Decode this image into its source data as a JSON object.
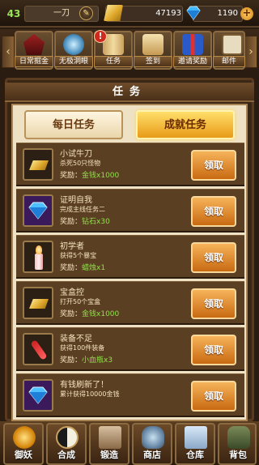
{
  "status": {
    "level": "43",
    "player_name": "一刀",
    "gold": "47193",
    "gems": "1190"
  },
  "nav": [
    {
      "label": "日常掘金",
      "icon": "house-icon"
    },
    {
      "label": "无极洞眼",
      "icon": "crystal-pool-icon"
    },
    {
      "label": "任务",
      "icon": "scroll-icon",
      "alert": "!"
    },
    {
      "label": "签到",
      "icon": "sign-in-icon"
    },
    {
      "label": "邀请奖励",
      "icon": "gift-icon"
    },
    {
      "label": "邮件",
      "icon": "mail-icon"
    }
  ],
  "panel": {
    "title": "任务",
    "tabs": {
      "daily": "每日任务",
      "achievement": "成就任务"
    },
    "selected_tab": "achievement"
  },
  "reward_prefix": "奖励：",
  "tasks": [
    {
      "title": "小试牛刀",
      "desc": "杀死50只怪物",
      "reward": "金钱x1000",
      "claim": "领取",
      "icon": "gold-bar-icon"
    },
    {
      "title": "证明自我",
      "desc": "完成主线任务二",
      "reward": "钻石x30",
      "claim": "领取",
      "icon": "diamond-icon"
    },
    {
      "title": "初学者",
      "desc": "获得5个暴宝",
      "reward": "蜡烛x1",
      "claim": "领取",
      "icon": "candle-icon"
    },
    {
      "title": "宝盒控",
      "desc": "打开50个宝盒",
      "reward": "金钱x1000",
      "claim": "领取",
      "icon": "gold-bar-icon"
    },
    {
      "title": "装备不足",
      "desc": "获得100件装备",
      "reward": "小血瓶x3",
      "claim": "领取",
      "icon": "potion-icon"
    },
    {
      "title": "有钱刷新了！",
      "desc": "累计获得10000金钱",
      "reward": "",
      "claim": "领取",
      "icon": "diamond-icon"
    }
  ],
  "bottom": [
    {
      "label": "御妖",
      "icon": "demon-seal-icon"
    },
    {
      "label": "合成",
      "icon": "yin-yang-icon"
    },
    {
      "label": "锻造",
      "icon": "book-icon"
    },
    {
      "label": "商店",
      "icon": "shop-bag-icon"
    },
    {
      "label": "仓库",
      "icon": "warehouse-icon"
    },
    {
      "label": "背包",
      "icon": "backpack-icon"
    }
  ],
  "colors": {
    "reward_value": "#8fe04a",
    "claim_button": "#e08a28",
    "selected_tab": "#f2b330"
  }
}
